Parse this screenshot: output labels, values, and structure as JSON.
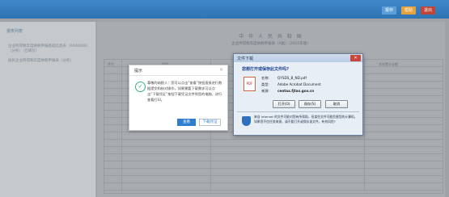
{
  "topbar": {
    "buttons": [
      "报存",
      "帮助",
      "退出"
    ]
  },
  "sidebar": {
    "title": "报表列表",
    "items": [
      "企业所得税年度纳税申报基础信息表（A000000）（分析）（已填写）",
      "居民企业所得税年度纳税申报表（分析）"
    ]
  },
  "content": {
    "title": "中 华 人 民 共 和 国",
    "subtitle": "企业所得税年度纳税申报表（A类）（2015年版）",
    "cells": [
      "序号",
      "项目",
      "金额",
      "本年累计金额"
    ]
  },
  "prompt": {
    "title": "提示",
    "message": "尊敬的纳税人：您可以点击“查看”按钮直接进行数据提交和核对操作，如果需要下载需求可以点击“下载凭证”按钮下载凭证文件到您的电脑，进行查看打印。",
    "ok": "查看",
    "download": "下载凭证"
  },
  "download_dialog": {
    "title": "文件下载",
    "question": "您想打开或保存此文件吗?",
    "name_label": "名称:",
    "name": "QYSDS_B_ND.pdf",
    "type_label": "类型:",
    "type": "Adobe Acrobat Document",
    "from_label": "来源:",
    "from": "centax.fjtax.gov.cn",
    "open": "打开(O)",
    "save": "保存(S)",
    "cancel": "取消",
    "warning": "来自 Internet 的文件可能对您有所帮助，但某些文件可能危害您的计算机。如果您不信任其来源，请不要打开或保存该文件。有何风险?"
  }
}
